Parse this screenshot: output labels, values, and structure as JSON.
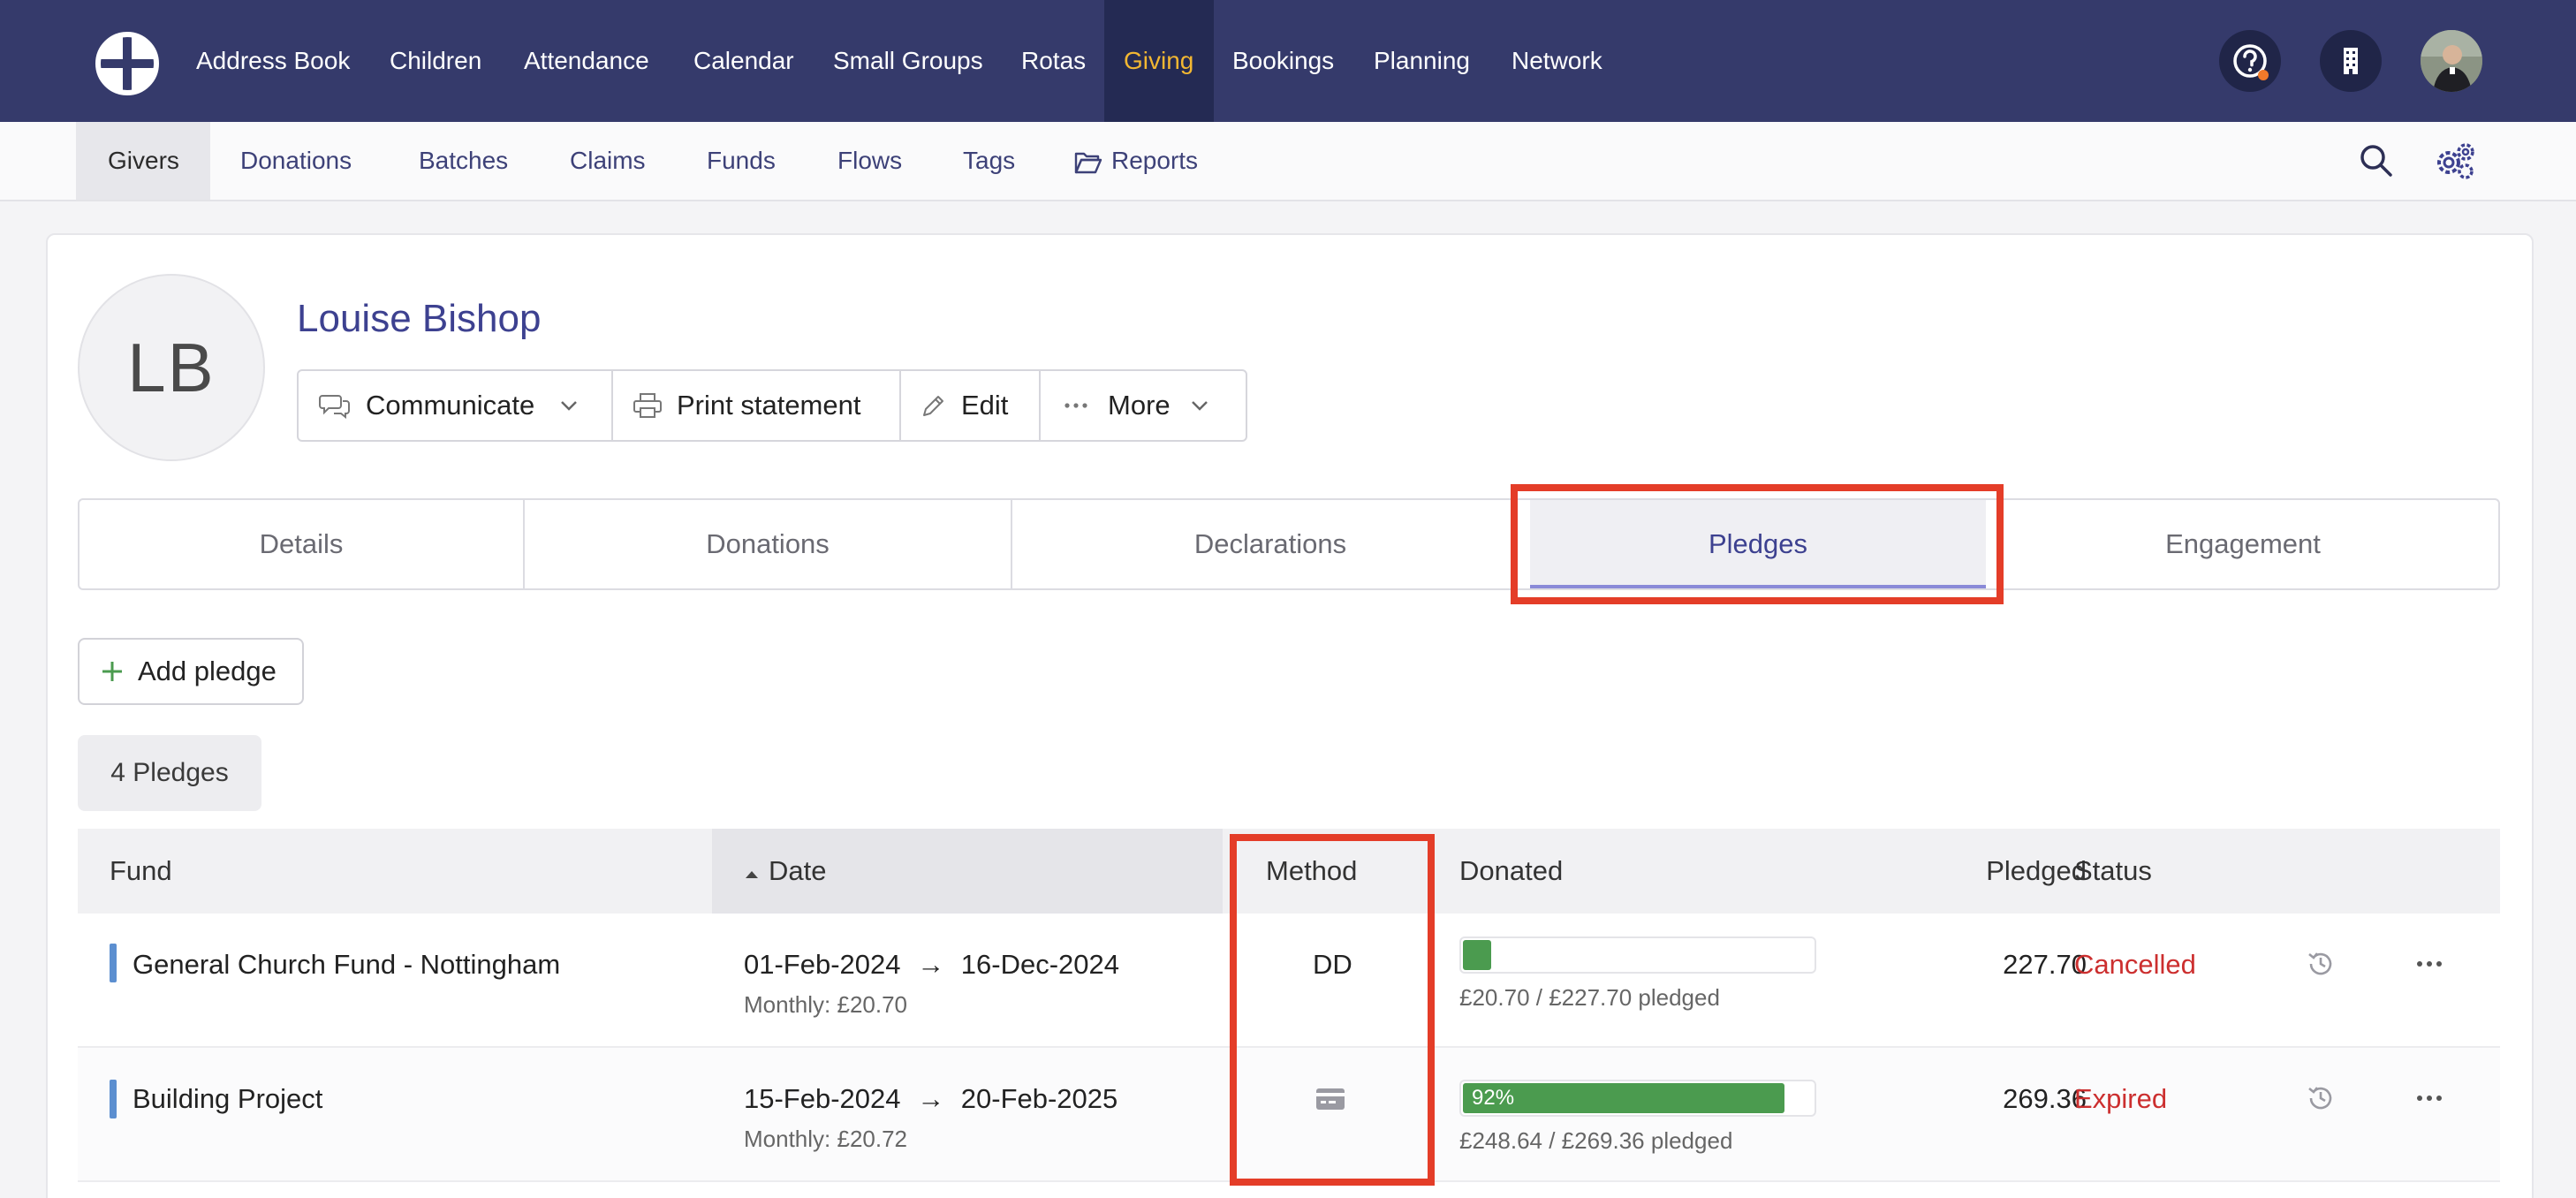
{
  "topnav": {
    "items": [
      "Address Book",
      "Children",
      "Attendance",
      "Calendar",
      "Small Groups",
      "Rotas",
      "Giving",
      "Bookings",
      "Planning",
      "Network"
    ],
    "active": "Giving",
    "icons": [
      "help-icon",
      "building-icon",
      "user-avatar"
    ]
  },
  "subnav": {
    "items": [
      "Givers",
      "Donations",
      "Batches",
      "Claims",
      "Funds",
      "Flows",
      "Tags"
    ],
    "reports": "Reports",
    "active": "Givers"
  },
  "giver": {
    "initials": "LB",
    "name": "Louise Bishop"
  },
  "actions": {
    "communicate": "Communicate",
    "print": "Print statement",
    "edit": "Edit",
    "more": "More"
  },
  "tabs": [
    "Details",
    "Donations",
    "Declarations",
    "Pledges",
    "Engagement"
  ],
  "active_tab": "Pledges",
  "add_pledge": "Add pledge",
  "pledge_count": "4 Pledges",
  "table": {
    "headers": {
      "fund": "Fund",
      "date": "Date",
      "method": "Method",
      "donated": "Donated",
      "pledged": "Pledged",
      "status": "Status"
    },
    "rows": [
      {
        "fund": "General Church Fund - Nottingham",
        "start": "01-Feb-2024",
        "arrow": "→",
        "end": "16-Dec-2024",
        "frequency": "Monthly: £20.70",
        "method": "DD",
        "progress_percent": 9,
        "progress_label": "",
        "donated_text": "£20.70 / £227.70 pledged",
        "pledged": "227.70",
        "status": "Cancelled"
      },
      {
        "fund": "Building Project",
        "start": "15-Feb-2024",
        "arrow": "→",
        "end": "20-Feb-2025",
        "frequency": "Monthly: £20.72",
        "method": "",
        "method_icon": "card-icon",
        "progress_percent": 92,
        "progress_label": "92%",
        "donated_text": "£248.64 / £269.36 pledged",
        "pledged": "269.36",
        "status": "Expired"
      }
    ]
  },
  "colors": {
    "nav_bg": "#353a6b",
    "accent_active": "#f2b732",
    "highlight": "#e43d28",
    "progress": "#4b9b4f",
    "status_red": "#cc2f2f"
  }
}
